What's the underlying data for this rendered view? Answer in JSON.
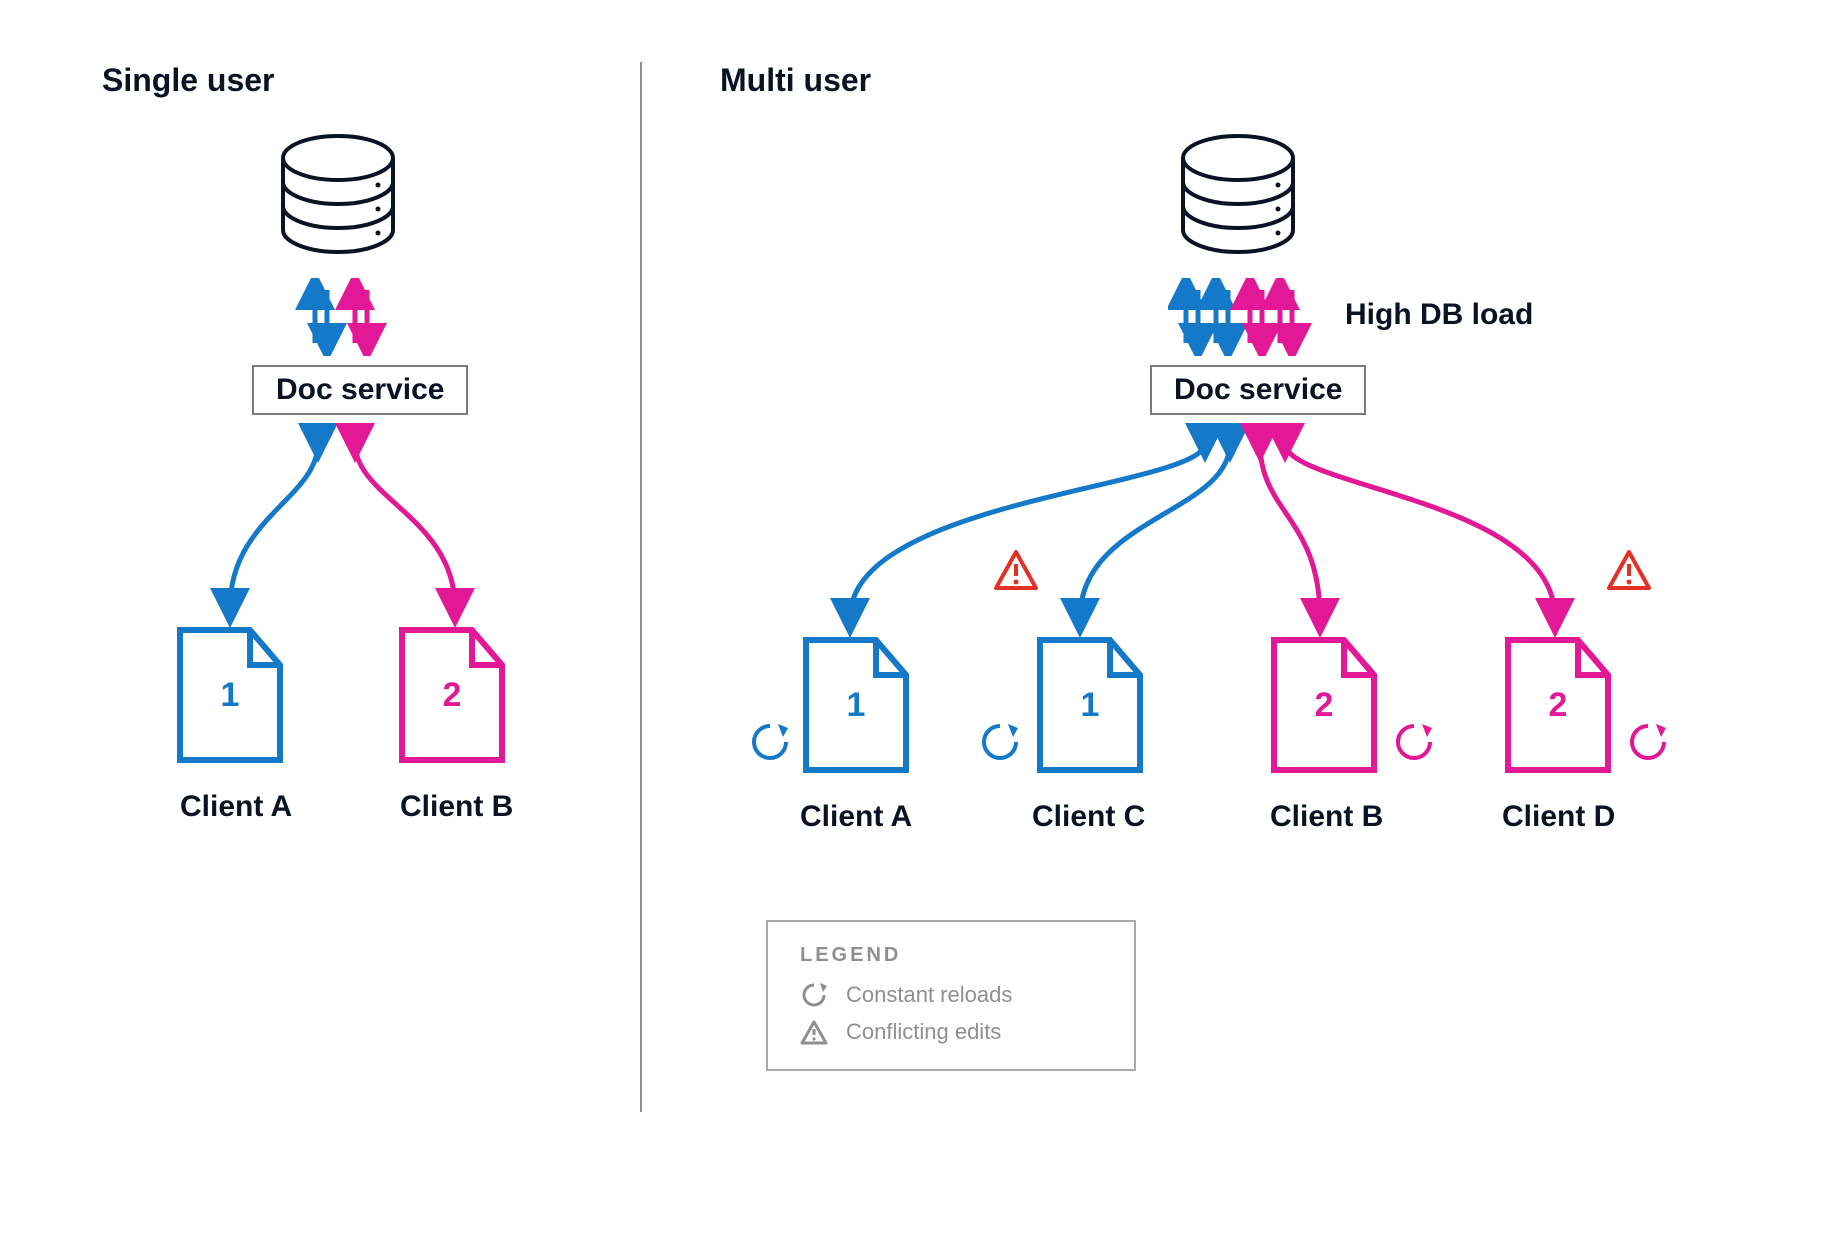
{
  "left": {
    "title": "Single user",
    "service": "Doc service",
    "clients": [
      {
        "name": "Client A",
        "doc": "1",
        "color": "blue"
      },
      {
        "name": "Client B",
        "doc": "2",
        "color": "magenta"
      }
    ]
  },
  "right": {
    "title": "Multi user",
    "service": "Doc service",
    "dbload": "High DB load",
    "clients": [
      {
        "name": "Client A",
        "doc": "1",
        "color": "blue"
      },
      {
        "name": "Client C",
        "doc": "1",
        "color": "blue",
        "conflict": true
      },
      {
        "name": "Client B",
        "doc": "2",
        "color": "magenta"
      },
      {
        "name": "Client D",
        "doc": "2",
        "color": "magenta",
        "conflict": true
      }
    ]
  },
  "legend": {
    "title": "LEGEND",
    "reload": "Constant reloads",
    "conflict": "Conflicting edits"
  },
  "colors": {
    "blue": "#1579c9",
    "magenta": "#e21896",
    "warning": "#e33225",
    "muted": "#8f8f91",
    "stroke": "#0a1323"
  }
}
